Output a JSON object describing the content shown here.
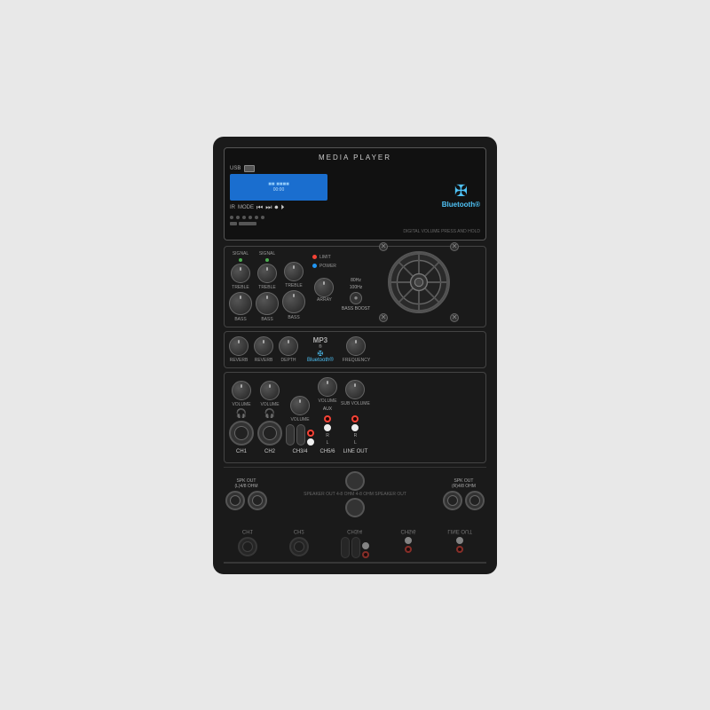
{
  "panel": {
    "title": "MEDIA PLAYER",
    "bluetooth_text": "Bluetooth®",
    "usb_label": "USB",
    "ir_label": "IR",
    "mode_label": "MODE",
    "digital_volume": "DIGITAL VOLUME PRESS AND HOLD",
    "limit_label": "LIMIT",
    "power_label": "POWER",
    "array_label": "ARRAY",
    "channels": [
      {
        "signal": "SIGNAL",
        "treble": "TREBLE",
        "bass": "BASS"
      },
      {
        "signal": "SIGNAL",
        "treble": "TREBLE",
        "bass": "BASS"
      },
      {
        "treble": "TREBLE",
        "bass": "BASS"
      }
    ],
    "reverb_row": [
      {
        "label": "REVERB"
      },
      {
        "label": "REVERB"
      },
      {
        "label": "DEPTH"
      },
      {
        "label": "FREQUENCY"
      }
    ],
    "volume_row": [
      {
        "label": "VOLUME"
      },
      {
        "label": "VOLUME"
      },
      {
        "label": "VOLUME"
      },
      {
        "label": "VOLUME"
      },
      {
        "label": "SUB VOLUME"
      }
    ],
    "bass_boost": {
      "label": "BASS BOOST",
      "option1": "80Hz",
      "option2": "100Hz"
    },
    "mp3_bluetooth": "MP3",
    "bluetooth_badge": "Bluetooth®",
    "channels_out": [
      "CH1",
      "CH2",
      "CH3/4",
      "CH5/6",
      "LINE OUT"
    ],
    "aux_label": "AUX",
    "spk_left": "SPK OUT\n(L)4/8 OHM",
    "spk_right": "SPK OUT\n(R)4/8 OHM",
    "speaker_out_center": "SPEAKER OUT\n4-8 OHM\n4-8 OHM\nSPEAKER OUT"
  }
}
